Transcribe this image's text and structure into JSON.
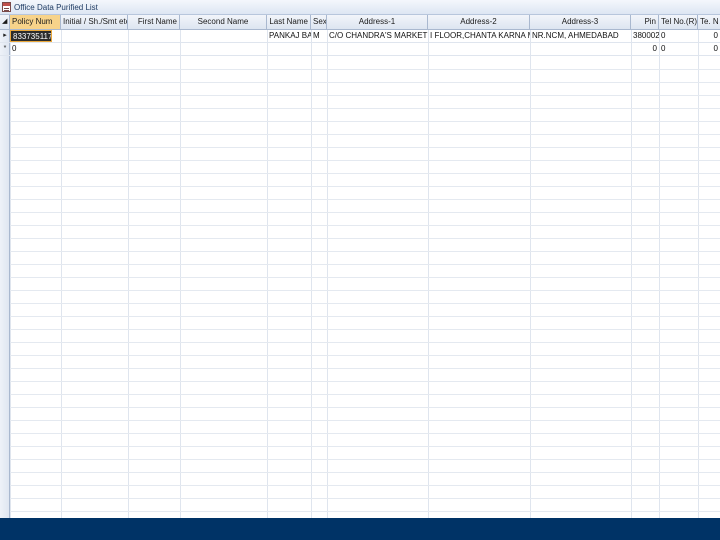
{
  "window": {
    "title": "Office Data Purified List",
    "icon": "form-icon"
  },
  "grid": {
    "columns": [
      {
        "key": "policy_num",
        "label": "Policy Num"
      },
      {
        "key": "initial",
        "label": "Initial / Sh./Smt etc."
      },
      {
        "key": "first_name",
        "label": "First Name"
      },
      {
        "key": "second_name",
        "label": "Second Name"
      },
      {
        "key": "last_name",
        "label": "Last Name"
      },
      {
        "key": "sex",
        "label": "Sex"
      },
      {
        "key": "address1",
        "label": "Address-1"
      },
      {
        "key": "address2",
        "label": "Address-2"
      },
      {
        "key": "address3",
        "label": "Address-3"
      },
      {
        "key": "pin",
        "label": "Pin"
      },
      {
        "key": "tel_r",
        "label": "Tel No.(R)"
      },
      {
        "key": "tel_m",
        "label": "Te. N"
      }
    ],
    "rows": [
      {
        "policy_num": "833735117",
        "initial": "",
        "first_name": "",
        "second_name": "",
        "last_name": "PANKAJ BA",
        "sex": "M",
        "address1": "C/O CHANDRA'S MARKETI",
        "address2": "I FLOOR,CHANTA KARNA MARG",
        "address3": "NR.NCM, AHMEDABAD",
        "pin": "380002",
        "tel_r": "0",
        "tel_m": "0"
      }
    ],
    "new_row": {
      "marker": "*",
      "policy_num": "0",
      "pin": "0",
      "tel_r": "0",
      "tel_m": "0"
    },
    "select_all_marker": "◢",
    "current_row_marker": "▸"
  },
  "colors": {
    "header_bg": "#dde5f1",
    "selected_header": "#f7d38a",
    "active_cell_bg": "#2b2b2b",
    "taskbar": "#003366"
  }
}
